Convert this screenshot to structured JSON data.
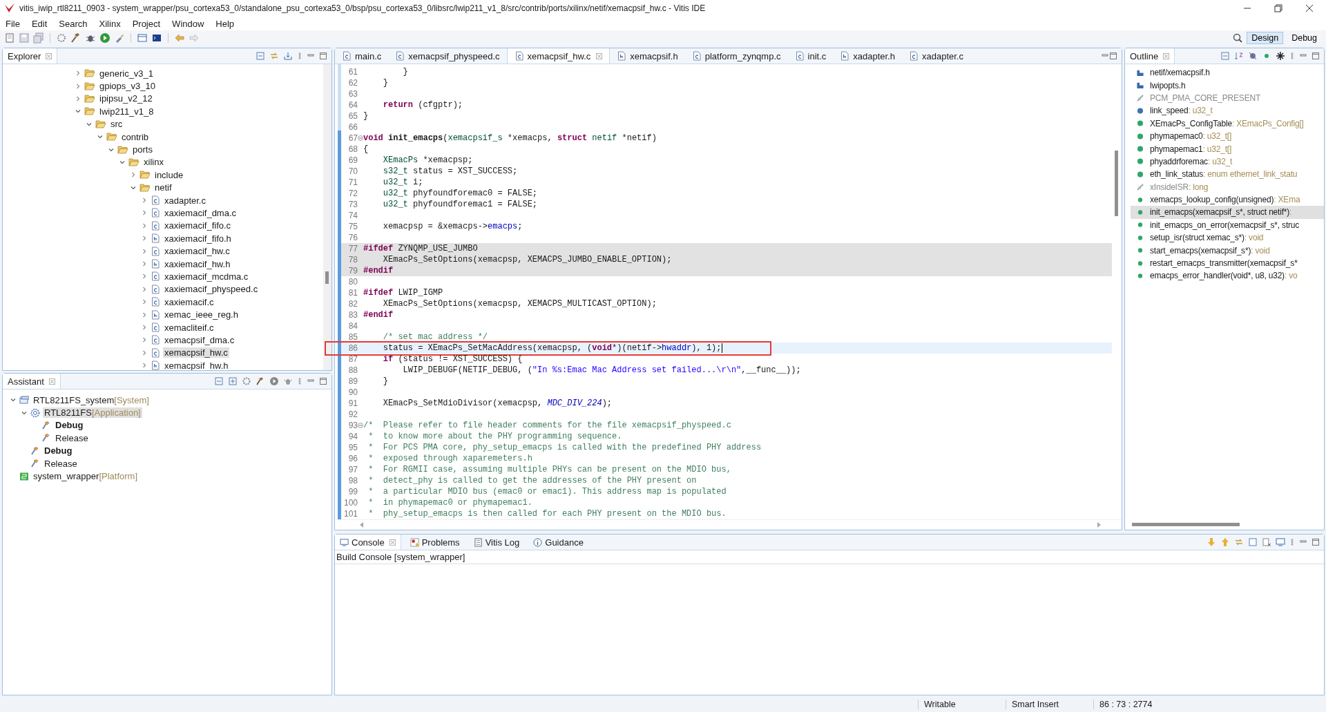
{
  "window": {
    "title": "vitis_iwip_rtl8211_0903 - system_wrapper/psu_cortexa53_0/standalone_psu_cortexa53_0/bsp/psu_cortexa53_0/libsrc/lwip211_v1_8/src/contrib/ports/xilinx/netif/xemacpsif_hw.c - Vitis IDE"
  },
  "menu": [
    "File",
    "Edit",
    "Search",
    "Xilinx",
    "Project",
    "Window",
    "Help"
  ],
  "perspectives": [
    {
      "label": "Design",
      "selected": true
    },
    {
      "label": "Debug",
      "selected": false
    }
  ],
  "explorer": {
    "title": "Explorer",
    "items": [
      {
        "name": "generic_v3_1",
        "kind": "folder",
        "expanded": false,
        "selected": false
      },
      {
        "name": "gpiops_v3_10",
        "kind": "folder",
        "expanded": false,
        "selected": false
      },
      {
        "name": "ipipsu_v2_12",
        "kind": "folder",
        "expanded": false,
        "selected": false
      },
      {
        "name": "lwip211_v1_8",
        "kind": "folder",
        "expanded": true,
        "selected": false,
        "children": [
          {
            "name": "src",
            "kind": "folder",
            "expanded": true,
            "selected": false,
            "children": [
              {
                "name": "contrib",
                "kind": "folder",
                "expanded": true,
                "selected": false,
                "children": [
                  {
                    "name": "ports",
                    "kind": "folder",
                    "expanded": true,
                    "selected": false,
                    "children": [
                      {
                        "name": "xilinx",
                        "kind": "folder",
                        "expanded": true,
                        "selected": false,
                        "children": [
                          {
                            "name": "include",
                            "kind": "folder",
                            "expanded": false,
                            "selected": false
                          },
                          {
                            "name": "netif",
                            "kind": "folder",
                            "expanded": true,
                            "selected": false,
                            "children": [
                              {
                                "name": "xadapter.c",
                                "kind": "c",
                                "expanded": false,
                                "selected": false
                              },
                              {
                                "name": "xaxiemacif_dma.c",
                                "kind": "c",
                                "expanded": false,
                                "selected": false
                              },
                              {
                                "name": "xaxiemacif_fifo.c",
                                "kind": "c",
                                "expanded": false,
                                "selected": false
                              },
                              {
                                "name": "xaxiemacif_fifo.h",
                                "kind": "h",
                                "expanded": false,
                                "selected": false
                              },
                              {
                                "name": "xaxiemacif_hw.c",
                                "kind": "c",
                                "expanded": false,
                                "selected": false
                              },
                              {
                                "name": "xaxiemacif_hw.h",
                                "kind": "h",
                                "expanded": false,
                                "selected": false
                              },
                              {
                                "name": "xaxiemacif_mcdma.c",
                                "kind": "c",
                                "expanded": false,
                                "selected": false
                              },
                              {
                                "name": "xaxiemacif_physpeed.c",
                                "kind": "c",
                                "expanded": false,
                                "selected": false
                              },
                              {
                                "name": "xaxiemacif.c",
                                "kind": "c",
                                "expanded": false,
                                "selected": false
                              },
                              {
                                "name": "xemac_ieee_reg.h",
                                "kind": "h",
                                "expanded": false,
                                "selected": false
                              },
                              {
                                "name": "xemacliteif.c",
                                "kind": "c",
                                "expanded": false,
                                "selected": false
                              },
                              {
                                "name": "xemacpsif_dma.c",
                                "kind": "c",
                                "expanded": false,
                                "selected": false
                              },
                              {
                                "name": "xemacpsif_hw.c",
                                "kind": "c",
                                "expanded": false,
                                "selected": true
                              },
                              {
                                "name": "xemacpsif_hw.h",
                                "kind": "h",
                                "expanded": false,
                                "selected": false
                              }
                            ]
                          }
                        ]
                      }
                    ]
                  }
                ]
              }
            ]
          }
        ]
      }
    ]
  },
  "assistant": {
    "title": "Assistant",
    "items": [
      {
        "name": "RTL8211FS_system",
        "tag": "[System]",
        "kind": "system",
        "expanded": true,
        "selected": false,
        "active": false,
        "children": [
          {
            "name": "RTL8211FS",
            "tag": "[Application]",
            "kind": "application",
            "expanded": true,
            "selected": true,
            "active": false,
            "children": [
              {
                "name": "Debug",
                "kind": "config",
                "selected": false,
                "active": true
              },
              {
                "name": "Release",
                "kind": "config",
                "selected": false,
                "active": false
              }
            ]
          },
          {
            "name": "Debug",
            "kind": "config",
            "selected": false,
            "active": true
          },
          {
            "name": "Release",
            "kind": "config",
            "selected": false,
            "active": false
          }
        ]
      },
      {
        "name": "system_wrapper",
        "tag": "[Platform]",
        "kind": "platform",
        "selected": false,
        "active": false
      }
    ]
  },
  "editor": {
    "tabs": [
      {
        "label": "main.c",
        "kind": "c",
        "selected": false
      },
      {
        "label": "xemacpsif_physpeed.c",
        "kind": "c",
        "selected": false
      },
      {
        "label": "xemacpsif_hw.c",
        "kind": "c",
        "selected": true
      },
      {
        "label": "xemacpsif.h",
        "kind": "h",
        "selected": false
      },
      {
        "label": "platform_zynqmp.c",
        "kind": "c",
        "selected": false
      },
      {
        "label": "init.c",
        "kind": "c",
        "selected": false
      },
      {
        "label": "xadapter.h",
        "kind": "h",
        "selected": false
      },
      {
        "label": "xadapter.c",
        "kind": "c",
        "selected": false
      }
    ],
    "lines": [
      {
        "number": "61",
        "kind": "normal",
        "foldable": false,
        "boxed": false,
        "tokens": [
          {
            "text": "        }",
            "kind": "plain"
          }
        ]
      },
      {
        "number": "62",
        "kind": "normal",
        "foldable": false,
        "boxed": false,
        "tokens": [
          {
            "text": "    }",
            "kind": "plain"
          }
        ]
      },
      {
        "number": "63",
        "kind": "normal",
        "foldable": false,
        "boxed": false
      },
      {
        "number": "64",
        "kind": "normal",
        "foldable": false,
        "boxed": false,
        "tokens": [
          {
            "text": "    return",
            "kind": "keyword"
          },
          {
            "text": " (cfgptr);",
            "kind": "plain"
          }
        ]
      },
      {
        "number": "65",
        "kind": "normal",
        "foldable": false,
        "boxed": false,
        "tokens": [
          {
            "text": "}",
            "kind": "plain"
          }
        ]
      },
      {
        "number": "66",
        "kind": "normal",
        "foldable": false,
        "boxed": false
      },
      {
        "number": "67",
        "kind": "normal",
        "foldable": true,
        "boxed": false,
        "tokens": [
          {
            "text": "void ",
            "kind": "keyword"
          },
          {
            "text": "init_emacps",
            "kind": "declaration"
          },
          {
            "text": "(",
            "kind": "plain"
          },
          {
            "text": "xemacpsif_s",
            "kind": "type"
          },
          {
            "text": " *xemacps, ",
            "kind": "plain"
          },
          {
            "text": "struct ",
            "kind": "keyword"
          },
          {
            "text": "netif",
            "kind": "type"
          },
          {
            "text": " *netif)",
            "kind": "plain"
          }
        ]
      },
      {
        "number": "68",
        "kind": "normal",
        "foldable": false,
        "boxed": false,
        "tokens": [
          {
            "text": "{",
            "kind": "plain"
          }
        ]
      },
      {
        "number": "69",
        "kind": "normal",
        "foldable": false,
        "boxed": false,
        "tokens": [
          {
            "text": "    XEmacPs",
            "kind": "type"
          },
          {
            "text": " *xemacpsp;",
            "kind": "plain"
          }
        ]
      },
      {
        "number": "70",
        "kind": "normal",
        "foldable": false,
        "boxed": false,
        "tokens": [
          {
            "text": "    s32_t",
            "kind": "type"
          },
          {
            "text": " status = XST_SUCCESS;",
            "kind": "plain"
          }
        ]
      },
      {
        "number": "71",
        "kind": "normal",
        "foldable": false,
        "boxed": false,
        "tokens": [
          {
            "text": "    u32_t",
            "kind": "type"
          },
          {
            "text": " i;",
            "kind": "plain"
          }
        ]
      },
      {
        "number": "72",
        "kind": "normal",
        "foldable": false,
        "boxed": false,
        "tokens": [
          {
            "text": "    u32_t",
            "kind": "type"
          },
          {
            "text": " phyfoundforemac0 = FALSE;",
            "kind": "plain"
          }
        ]
      },
      {
        "number": "73",
        "kind": "normal",
        "foldable": false,
        "boxed": false,
        "tokens": [
          {
            "text": "    u32_t",
            "kind": "type"
          },
          {
            "text": " phyfoundforemac1 = FALSE;",
            "kind": "plain"
          }
        ]
      },
      {
        "number": "74",
        "kind": "normal",
        "foldable": false,
        "boxed": false
      },
      {
        "number": "75",
        "kind": "normal",
        "foldable": false,
        "boxed": false,
        "tokens": [
          {
            "text": "    xemacpsp = &xemacps->",
            "kind": "plain"
          },
          {
            "text": "emacps",
            "kind": "field"
          },
          {
            "text": ";",
            "kind": "plain"
          }
        ]
      },
      {
        "number": "76",
        "kind": "normal",
        "foldable": false,
        "boxed": false
      },
      {
        "number": "77",
        "kind": "inactive",
        "foldable": false,
        "boxed": false,
        "tokens": [
          {
            "text": "#ifdef",
            "kind": "keyword"
          },
          {
            "text": " ZYNQMP_USE_JUMBO",
            "kind": "plain"
          }
        ]
      },
      {
        "number": "78",
        "kind": "inactive",
        "foldable": false,
        "boxed": false,
        "tokens": [
          {
            "text": "    XEmacPs_SetOptions(xemacpsp, XEMACPS_JUMBO_ENABLE_OPTION);",
            "kind": "plain"
          }
        ]
      },
      {
        "number": "79",
        "kind": "inactive",
        "foldable": false,
        "boxed": false,
        "tokens": [
          {
            "text": "#endif",
            "kind": "keyword"
          }
        ]
      },
      {
        "number": "80",
        "kind": "normal",
        "foldable": false,
        "boxed": false
      },
      {
        "number": "81",
        "kind": "normal",
        "foldable": false,
        "boxed": false,
        "tokens": [
          {
            "text": "#ifdef",
            "kind": "keyword"
          },
          {
            "text": " LWIP_IGMP",
            "kind": "plain"
          }
        ]
      },
      {
        "number": "82",
        "kind": "normal",
        "foldable": false,
        "boxed": false,
        "tokens": [
          {
            "text": "    XEmacPs_SetOptions(xemacpsp, XEMACPS_MULTICAST_OPTION);",
            "kind": "plain"
          }
        ]
      },
      {
        "number": "83",
        "kind": "normal",
        "foldable": false,
        "boxed": false,
        "tokens": [
          {
            "text": "#endif",
            "kind": "keyword"
          }
        ]
      },
      {
        "number": "84",
        "kind": "normal",
        "foldable": false,
        "boxed": false
      },
      {
        "number": "85",
        "kind": "normal",
        "foldable": false,
        "boxed": false,
        "tokens": [
          {
            "text": "    /* set mac address */",
            "kind": "comment"
          }
        ]
      },
      {
        "number": "86",
        "kind": "current",
        "foldable": false,
        "boxed": true,
        "tokens": [
          {
            "text": "    status = XEmacPs_SetMacAddress(xemacpsp, (",
            "kind": "plain"
          },
          {
            "text": "void",
            "kind": "keyword"
          },
          {
            "text": "*)(netif->",
            "kind": "plain"
          },
          {
            "text": "hwaddr",
            "kind": "field"
          },
          {
            "text": "), 1);",
            "kind": "plain"
          }
        ]
      },
      {
        "number": "87",
        "kind": "normal",
        "foldable": false,
        "boxed": false,
        "tokens": [
          {
            "text": "    if",
            "kind": "keyword"
          },
          {
            "text": " (status != XST_SUCCESS) {",
            "kind": "plain"
          }
        ]
      },
      {
        "number": "88",
        "kind": "normal",
        "foldable": false,
        "boxed": false,
        "tokens": [
          {
            "text": "        LWIP_DEBUGF(NETIF_DEBUG, (",
            "kind": "plain"
          },
          {
            "text": "\"In %s:Emac Mac Address set failed...\\r\\n\"",
            "kind": "string"
          },
          {
            "text": ",__func__));",
            "kind": "plain"
          }
        ]
      },
      {
        "number": "89",
        "kind": "normal",
        "foldable": false,
        "boxed": false,
        "tokens": [
          {
            "text": "    }",
            "kind": "plain"
          }
        ]
      },
      {
        "number": "90",
        "kind": "normal",
        "foldable": false,
        "boxed": false
      },
      {
        "number": "91",
        "kind": "normal",
        "foldable": false,
        "boxed": false,
        "tokens": [
          {
            "text": "    XEmacPs_SetMdioDivisor(xemacpsp, ",
            "kind": "plain"
          },
          {
            "text": "MDC_DIV_224",
            "kind": "macro"
          },
          {
            "text": ");",
            "kind": "plain"
          }
        ]
      },
      {
        "number": "92",
        "kind": "normal",
        "foldable": false,
        "boxed": false
      },
      {
        "number": "93",
        "kind": "normal",
        "foldable": true,
        "boxed": false,
        "tokens": [
          {
            "text": "/*  Please refer to file header comments for the file xemacpsif_physpeed.c",
            "kind": "comment"
          }
        ]
      },
      {
        "number": "94",
        "kind": "normal",
        "foldable": false,
        "boxed": false,
        "tokens": [
          {
            "text": " *  to know more about the PHY programming sequence.",
            "kind": "comment"
          }
        ]
      },
      {
        "number": "95",
        "kind": "normal",
        "foldable": false,
        "boxed": false,
        "tokens": [
          {
            "text": " *  For PCS PMA core, phy_setup_emacps is called with the predefined PHY address",
            "kind": "comment"
          }
        ]
      },
      {
        "number": "96",
        "kind": "normal",
        "foldable": false,
        "boxed": false,
        "tokens": [
          {
            "text": " *  exposed through xaparemeters.h",
            "kind": "comment"
          }
        ]
      },
      {
        "number": "97",
        "kind": "normal",
        "foldable": false,
        "boxed": false,
        "tokens": [
          {
            "text": " *  For RGMII case, assuming multiple PHYs can be present on the MDIO bus,",
            "kind": "comment"
          }
        ]
      },
      {
        "number": "98",
        "kind": "normal",
        "foldable": false,
        "boxed": false,
        "tokens": [
          {
            "text": " *  detect_phy is called to get the addresses of the PHY present on",
            "kind": "comment"
          }
        ]
      },
      {
        "number": "99",
        "kind": "normal",
        "foldable": false,
        "boxed": false,
        "tokens": [
          {
            "text": " *  a particular MDIO bus (emac0 or emac1). This address map is populated",
            "kind": "comment"
          }
        ]
      },
      {
        "number": "100",
        "kind": "normal",
        "foldable": false,
        "boxed": false,
        "tokens": [
          {
            "text": " *  in phymapemac0 or phymapemac1.",
            "kind": "comment"
          }
        ]
      },
      {
        "number": "101",
        "kind": "normal",
        "foldable": false,
        "boxed": false,
        "tokens": [
          {
            "text": " *  phy_setup_emacps is then called for each PHY present on the MDIO bus.",
            "kind": "comment"
          }
        ]
      }
    ]
  },
  "outline": {
    "title": "Outline",
    "items": [
      {
        "name": "netif/xemacpsif.h",
        "kind": "include",
        "inactive": false,
        "selected": false
      },
      {
        "name": "lwipopts.h",
        "kind": "include",
        "inactive": false,
        "selected": false
      },
      {
        "name": "PCM_PMA_CORE_PRESENT",
        "kind": "macro",
        "inactive": true,
        "selected": false
      },
      {
        "name": "link_speed",
        "type": ": u32_t",
        "kind": "variable",
        "color": "#3d72b8",
        "inactive": false,
        "selected": false
      },
      {
        "name": "XEmacPs_ConfigTable",
        "type": ": XEmacPs_Config[]",
        "kind": "variable",
        "color": "#2fa66a",
        "inactive": false,
        "selected": false
      },
      {
        "name": "phymapemac0",
        "type": ": u32_t[]",
        "kind": "variable",
        "color": "#2fa66a",
        "inactive": false,
        "selected": false
      },
      {
        "name": "phymapemac1",
        "type": ": u32_t[]",
        "kind": "variable",
        "color": "#2fa66a",
        "inactive": false,
        "selected": false
      },
      {
        "name": "phyaddrforemac",
        "type": ": u32_t",
        "kind": "variable",
        "color": "#2fa66a",
        "inactive": false,
        "selected": false
      },
      {
        "name": "eth_link_status",
        "type": ": enum ethernet_link_statu",
        "kind": "variable",
        "color": "#2fa66a",
        "inactive": false,
        "selected": false
      },
      {
        "name": "xInsideISR",
        "type": ": long",
        "kind": "macro",
        "inactive": true,
        "selected": false
      },
      {
        "name": "xemacps_lookup_config(unsigned)",
        "type": ": XEma",
        "kind": "function",
        "color": "#2fa66a",
        "inactive": false,
        "selected": false
      },
      {
        "name": "init_emacps(xemacpsif_s*, struct netif*)",
        "type": ":",
        "kind": "function",
        "color": "#2fa66a",
        "inactive": false,
        "selected": true
      },
      {
        "name": "init_emacps_on_error(xemacpsif_s*, struc",
        "kind": "function",
        "color": "#2fa66a",
        "inactive": false,
        "selected": false
      },
      {
        "name": "setup_isr(struct xemac_s*)",
        "type": ": void",
        "kind": "function",
        "color": "#2fa66a",
        "inactive": false,
        "selected": false
      },
      {
        "name": "start_emacps(xemacpsif_s*)",
        "type": ": void",
        "kind": "function",
        "color": "#2fa66a",
        "inactive": false,
        "selected": false
      },
      {
        "name": "restart_emacps_transmitter(xemacpsif_s*",
        "kind": "function",
        "color": "#2fa66a",
        "inactive": false,
        "selected": false
      },
      {
        "name": "emacps_error_handler(void*, u8, u32)",
        "type": ": vo",
        "kind": "function",
        "color": "#2fa66a",
        "inactive": false,
        "selected": false
      }
    ]
  },
  "console": {
    "tabs": [
      {
        "label": "Console",
        "kind": "console",
        "selected": true
      },
      {
        "label": "Problems",
        "kind": "problems",
        "selected": false
      },
      {
        "label": "Vitis Log",
        "kind": "log",
        "selected": false
      },
      {
        "label": "Guidance",
        "kind": "info",
        "selected": false
      }
    ],
    "heading": "Build Console [system_wrapper]"
  },
  "status_bar": [
    "Writable",
    "Smart Insert",
    "86 : 73 : 2774"
  ]
}
